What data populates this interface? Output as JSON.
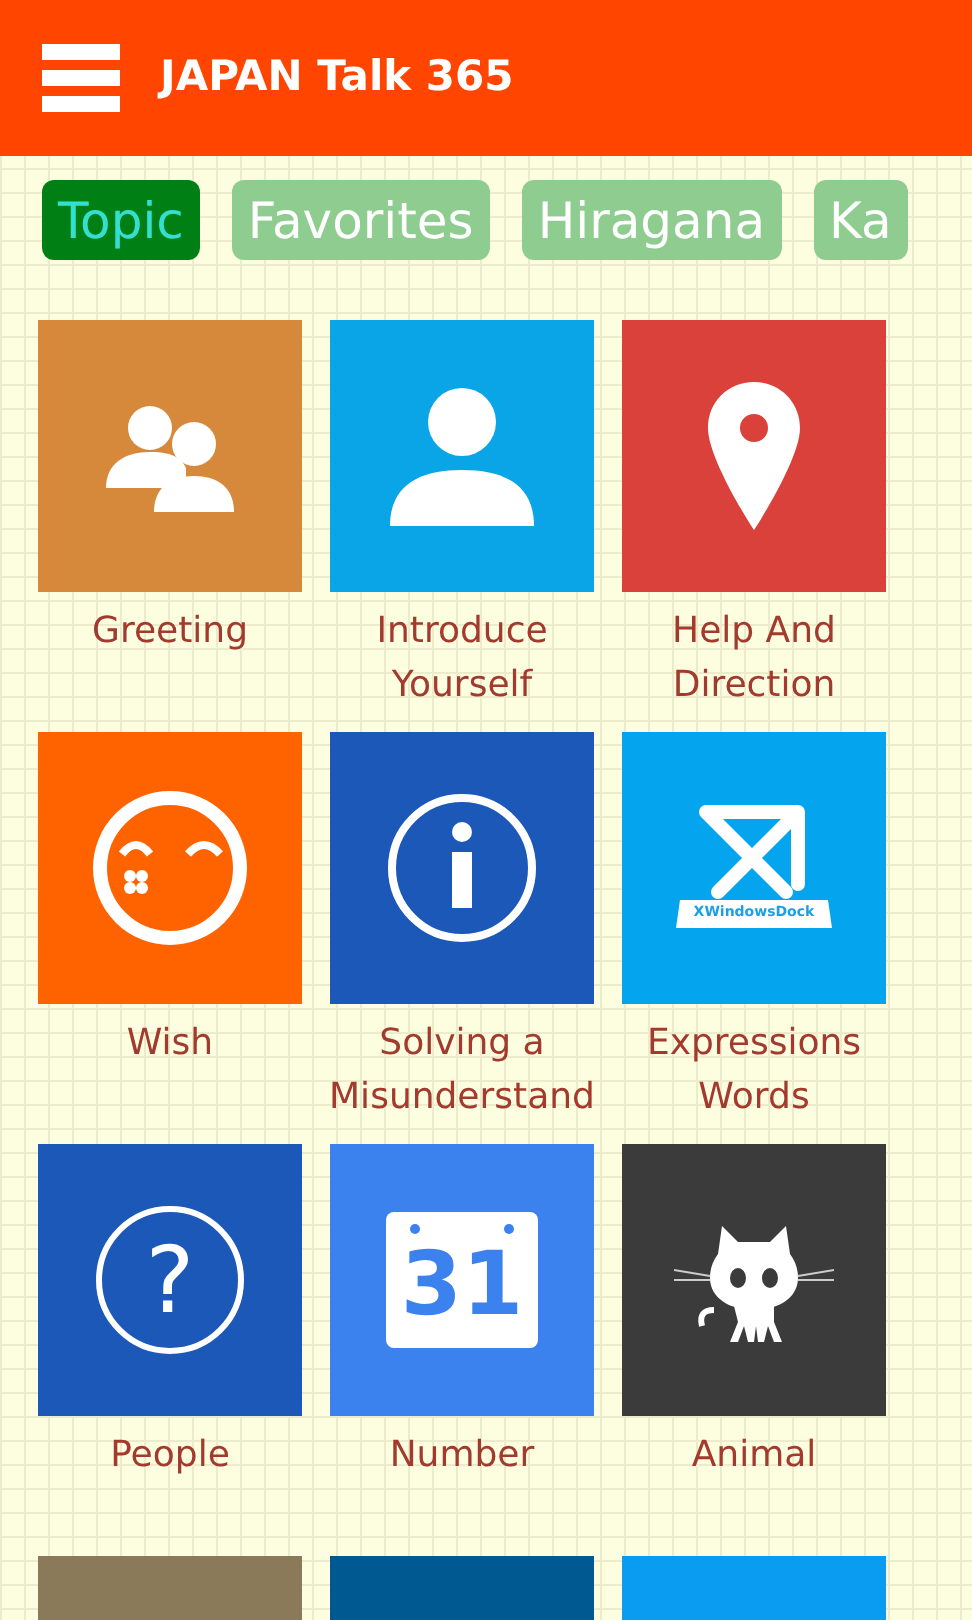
{
  "app_bar": {
    "title": "JAPAN Talk 365"
  },
  "tabs": [
    {
      "label": "Topic",
      "selected": true
    },
    {
      "label": "Favorites",
      "selected": false
    },
    {
      "label": "Hiragana",
      "selected": false
    },
    {
      "label": "Ka",
      "selected": false
    }
  ],
  "tiles": [
    {
      "kind": "people",
      "color": "#d6893b",
      "label": "Greeting"
    },
    {
      "kind": "person",
      "color": "#0aa5e6",
      "label": "Introduce Yourself"
    },
    {
      "kind": "pin",
      "color": "#d9413a",
      "label": "Help And Direction"
    },
    {
      "kind": "smiley",
      "color": "#ff6300",
      "label": "Wish"
    },
    {
      "kind": "info",
      "color": "#1b58b8",
      "label": "Solving a Misunderstand"
    },
    {
      "kind": "dock",
      "color": "#05a4ef",
      "label": "Expressions Words",
      "icon_text": "XWindowsDock"
    },
    {
      "kind": "question",
      "color": "#1b58b8",
      "label": "People",
      "icon_text": "?"
    },
    {
      "kind": "calendar",
      "color": "#3c82ee",
      "label": "Number",
      "icon_text": "31"
    },
    {
      "kind": "octocat",
      "color": "#3b3b3b",
      "label": "Animal"
    },
    {
      "kind": "partial",
      "color": "#8a7a5a"
    },
    {
      "kind": "partial",
      "color": "#005a92"
    },
    {
      "kind": "partial",
      "color": "#0a9cf0"
    }
  ]
}
